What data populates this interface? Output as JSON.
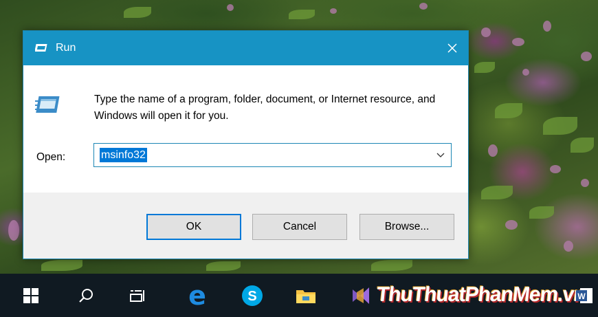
{
  "dialog": {
    "title": "Run",
    "message": "Type the name of a program, folder, document, or Internet resource, and Windows will open it for you.",
    "open_label": "Open:",
    "open_value": "msinfo32",
    "buttons": {
      "ok": "OK",
      "cancel": "Cancel",
      "browse": "Browse..."
    }
  },
  "taskbar": {
    "icons": [
      "windows-start-icon",
      "search-icon",
      "task-view-icon",
      "edge-icon",
      "skype-icon",
      "file-explorer-icon",
      "visual-studio-icon",
      "word-icon"
    ],
    "watermark": "ThuThuatPhanMem.vn"
  },
  "colors": {
    "title_bar": "#1793c4",
    "selection": "#0078d7",
    "taskbar": "#101a22"
  }
}
